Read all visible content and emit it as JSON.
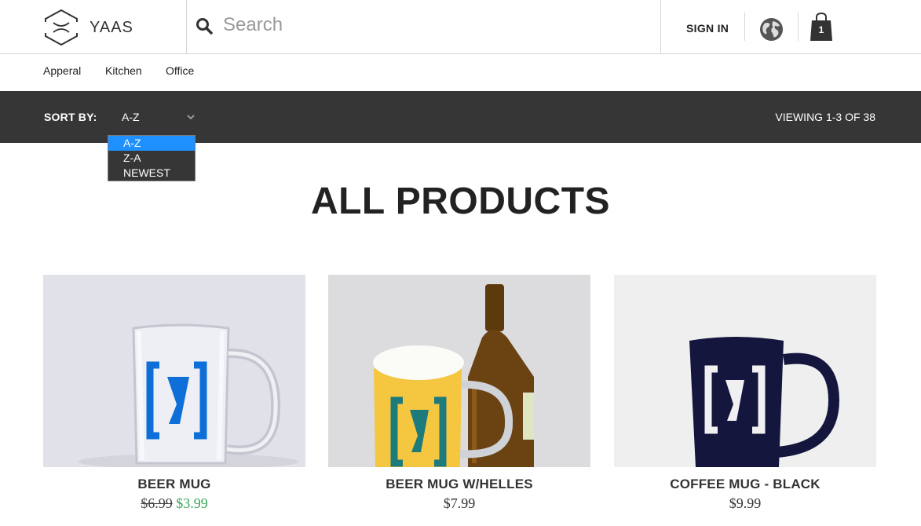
{
  "header": {
    "logo_text": "YAAS",
    "search_placeholder": "Search",
    "sign_in": "SIGN IN",
    "cart_count": "1"
  },
  "categories": [
    "Apperal",
    "Kitchen",
    "Office"
  ],
  "sortbar": {
    "label": "SORT BY:",
    "selected": "A-Z",
    "options": [
      "A-Z",
      "Z-A",
      "NEWEST"
    ],
    "viewing": "VIEWING 1-3 OF 38"
  },
  "page_title": "ALL PRODUCTS",
  "products": [
    {
      "name": "BEER MUG",
      "old_price": "$6.99",
      "price": "$3.99"
    },
    {
      "name": "BEER MUG W/HELLES",
      "price": "$7.99"
    },
    {
      "name": "COFFEE MUG - BLACK",
      "price": "$9.99"
    }
  ],
  "colors": {
    "sortbar_bg": "#363636",
    "dropdown_selected": "#1e90ff",
    "sale_price": "#3aa35a"
  }
}
